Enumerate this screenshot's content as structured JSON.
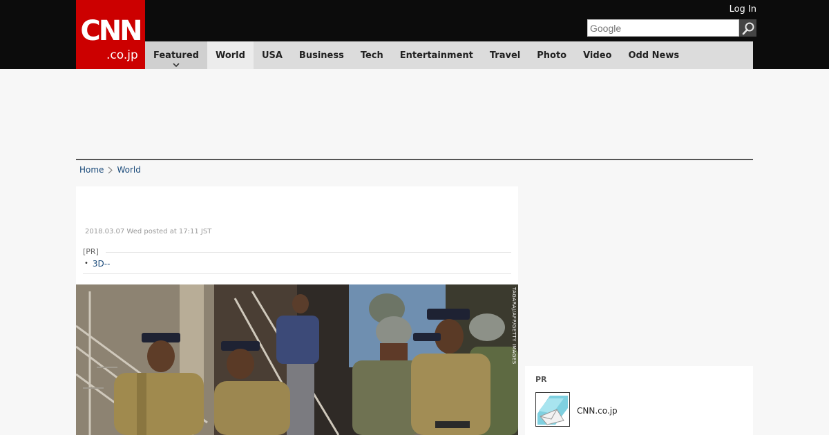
{
  "header": {
    "logo_main": "CNN",
    "logo_sub": ".co.jp",
    "login_label": "Log In",
    "search": {
      "placeholder": "Google",
      "value": ""
    },
    "search_icon": "search-icon"
  },
  "nav": {
    "items": [
      {
        "label": "Featured",
        "has_dropdown": true
      },
      {
        "label": "World",
        "active": true
      },
      {
        "label": "USA"
      },
      {
        "label": "Business"
      },
      {
        "label": "Tech"
      },
      {
        "label": "Entertainment"
      },
      {
        "label": "Travel"
      },
      {
        "label": "Photo"
      },
      {
        "label": "Video"
      },
      {
        "label": "Odd News"
      }
    ]
  },
  "breadcrumb": {
    "items": [
      "Home",
      "World"
    ],
    "separator_icon": "chevron-right-icon"
  },
  "article": {
    "posted": "2018.03.07 Wed posted at 17:11 JST",
    "pr_label": "[PR]",
    "pr_links": [
      "3D--"
    ],
    "photo_credit": "TAGARAJ/AFP/GETTY IMAGES"
  },
  "sidebar": {
    "pr": {
      "label": "PR",
      "items": [
        {
          "text": "CNN.co.jp",
          "icon": "mail-envelope-icon"
        }
      ]
    }
  },
  "colors": {
    "brand_red": "#cc0000",
    "topbar": "#0c0c0c",
    "nav_bg": "#dcdcdc",
    "link": "#1a4a7a"
  }
}
